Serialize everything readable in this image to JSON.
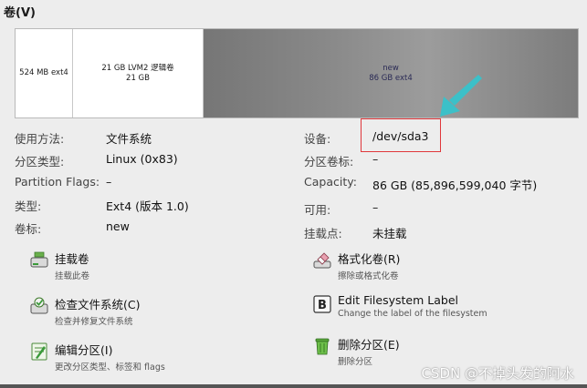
{
  "section": {
    "title": "卷(V)"
  },
  "volume_bar": {
    "segments": [
      {
        "line1": "524 MB ext4",
        "line2": ""
      },
      {
        "line1": "21 GB LVM2 逻辑卷",
        "line2": "21 GB"
      },
      {
        "line1": "new",
        "line2": "86 GB ext4"
      }
    ]
  },
  "properties_left": [
    {
      "label": "使用方法:",
      "value": "文件系统"
    },
    {
      "label": "分区类型:",
      "value": "Linux (0x83)"
    },
    {
      "label": "Partition Flags:",
      "value": "–"
    },
    {
      "label": "类型:",
      "value": "Ext4 (版本 1.0)"
    },
    {
      "label": "卷标:",
      "value": "new"
    }
  ],
  "properties_right": [
    {
      "label": "设备:",
      "value": "/dev/sda3"
    },
    {
      "label": "分区卷标:",
      "value": "–"
    },
    {
      "label": "Capacity:",
      "value": "86 GB (85,896,599,040 字节)"
    },
    {
      "label": "可用:",
      "value": "–"
    },
    {
      "label": "挂载点:",
      "value": "未挂载"
    }
  ],
  "actions_left": [
    {
      "title": "挂载卷",
      "subtitle": "挂载此卷",
      "icon": "mount-drive-icon"
    },
    {
      "title": "检查文件系统(C)",
      "subtitle": "检查并修复文件系统",
      "icon": "check-filesystem-icon"
    },
    {
      "title": "编辑分区(I)",
      "subtitle": "更改分区类型、标签和 flags",
      "icon": "edit-partition-icon"
    }
  ],
  "actions_right": [
    {
      "title": "格式化卷(R)",
      "subtitle": "擦除或格式化卷",
      "icon": "format-eraser-icon"
    },
    {
      "title": "Edit Filesystem Label",
      "subtitle": "Change the label of the filesystem",
      "icon": "label-b-icon"
    },
    {
      "title": "删除分区(E)",
      "subtitle": "删除分区",
      "icon": "trash-icon"
    }
  ],
  "watermark": "CSDN @不掉头发的阿水",
  "colors": {
    "highlight": "#e0373b",
    "arrow": "#3cc0c8"
  }
}
